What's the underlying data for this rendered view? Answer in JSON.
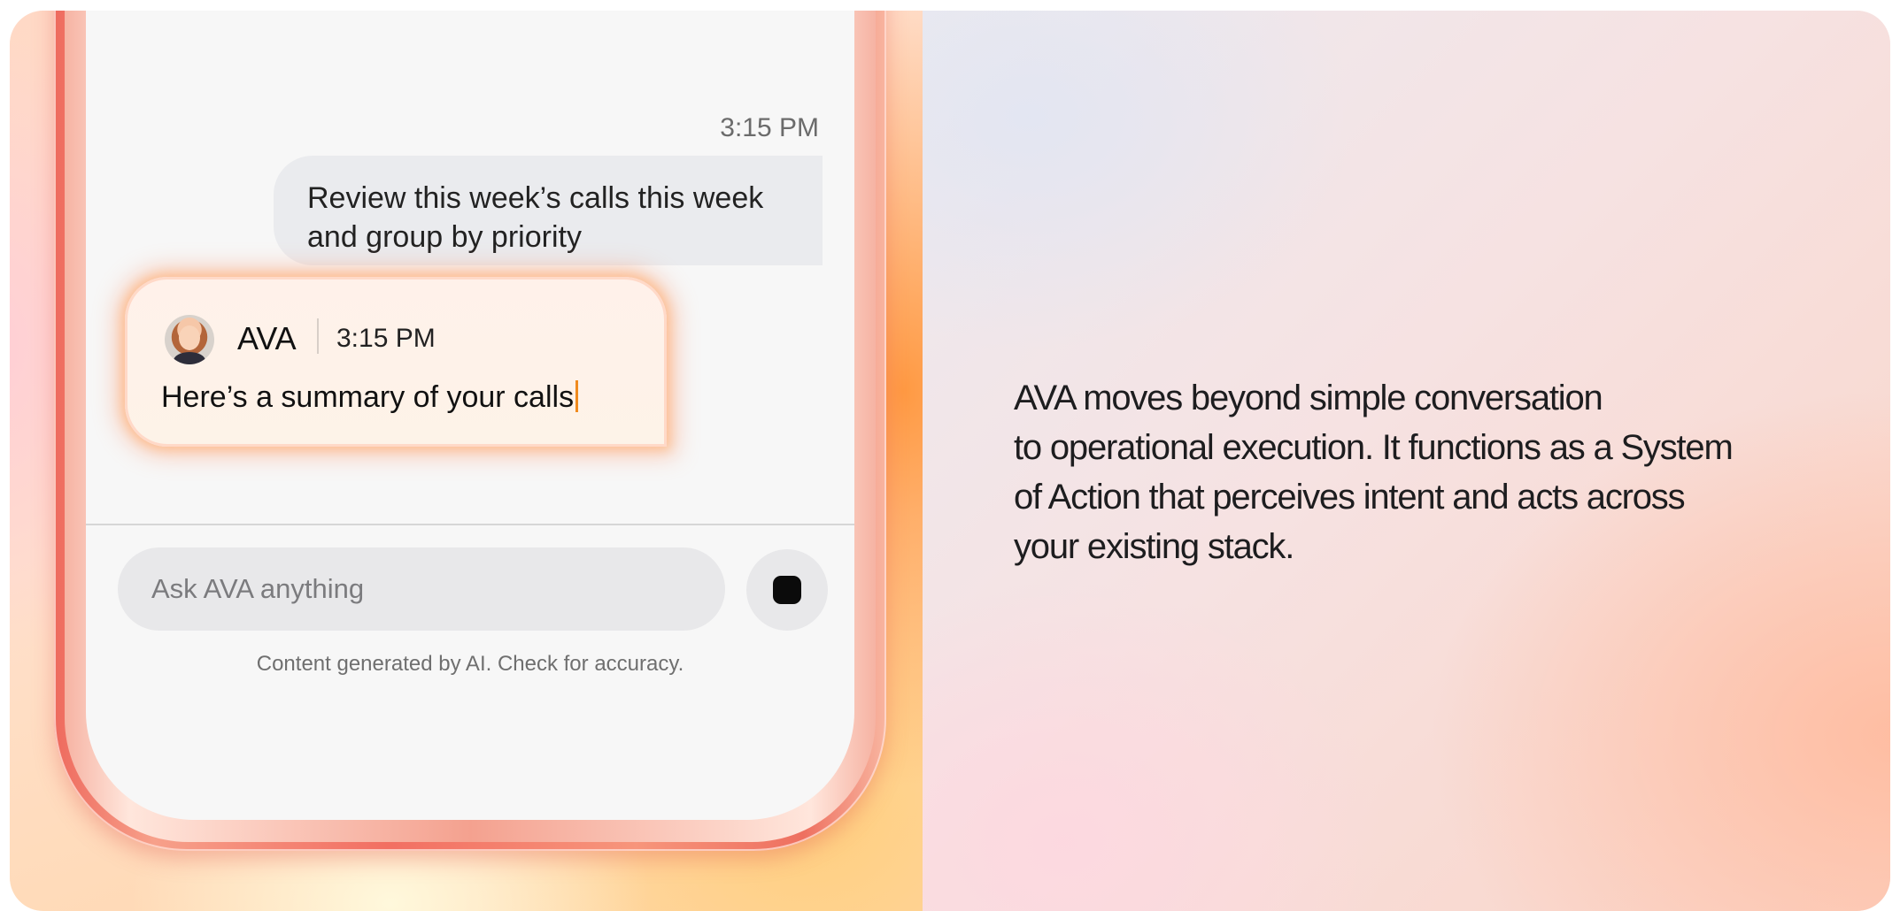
{
  "chat": {
    "user_message": {
      "timestamp": "3:15 PM",
      "text": "Review this week’s calls this week and group by priority"
    },
    "ava_message": {
      "sender": "AVA",
      "timestamp": "3:15 PM",
      "text": "Here’s a summary of your calls",
      "avatar_icon": "avatar-icon"
    },
    "composer": {
      "placeholder": "Ask AVA anything",
      "value": "",
      "send_icon": "stop-icon"
    },
    "disclaimer": "Content generated by AI. Check for accuracy."
  },
  "description": {
    "lines": [
      "AVA moves beyond simple conversation",
      "to operational execution. It functions as a System",
      "of Action that perceives intent and acts across",
      "your existing stack."
    ]
  },
  "colors": {
    "cursor_accent": "#f08a1e",
    "phone_frame": "#f26f62",
    "text_primary": "#1d1d1f"
  }
}
